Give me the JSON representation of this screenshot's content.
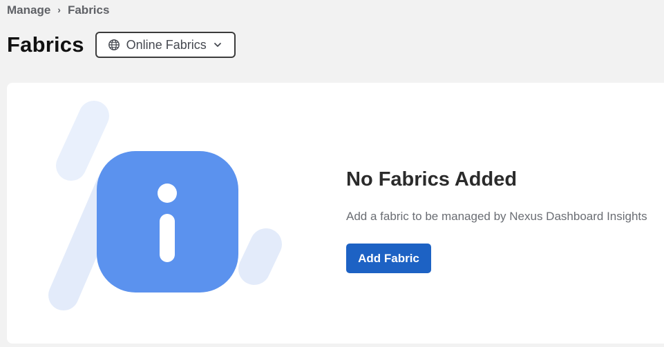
{
  "breadcrumb": {
    "items": [
      "Manage",
      "Fabrics"
    ],
    "separator": "›"
  },
  "header": {
    "title": "Fabrics",
    "scope_dropdown": {
      "label": "Online Fabrics",
      "icon": "globe-icon",
      "chevron": "chevron-down-icon"
    }
  },
  "empty_state": {
    "icon": "info-icon",
    "title": "No Fabrics Added",
    "description": "Add a fabric to be managed by Nexus Dashboard Insights",
    "action_label": "Add Fabric"
  },
  "colors": {
    "page_bg": "#f2f2f2",
    "card_bg": "#ffffff",
    "primary": "#1d62c4",
    "info_tile": "#5b92ee",
    "decor_light": "#e6eefb"
  }
}
